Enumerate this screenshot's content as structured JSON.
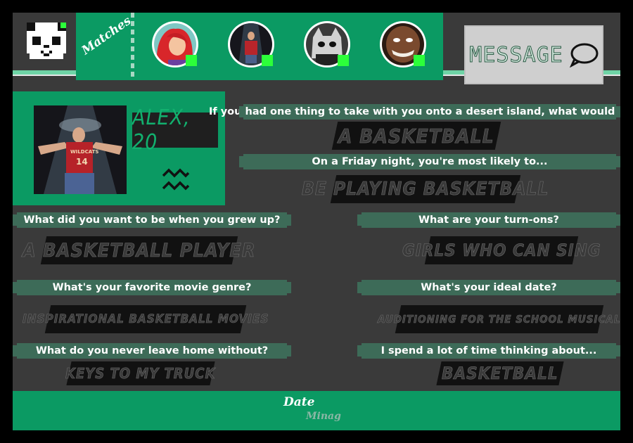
{
  "nav": {
    "matches_label": "Matches",
    "message_label": "MESSAGE"
  },
  "matches": [
    {
      "name": "match-ariel",
      "status_color": "#2cff3a"
    },
    {
      "name": "match-alex",
      "status_color": "#2cff3a"
    },
    {
      "name": "match-cat",
      "status_color": "#2cff3a"
    },
    {
      "name": "match-grin",
      "status_color": "#2cff3a"
    }
  ],
  "profile": {
    "name": "ALEX, 20",
    "zodiac_icon": "aquarius-icon"
  },
  "qa": [
    {
      "question": "If you had one thing to take with you onto a desert island, what would it be?",
      "answer": "A BASKETBALL"
    },
    {
      "question": "On a Friday night, you're most likely to...",
      "answer": "BE PLAYING BASKETBALL"
    },
    {
      "question": "What did you want to be when you grew up?",
      "answer": "A BASKETBALL PLAYER"
    },
    {
      "question": "What are your turn-ons?",
      "answer": "GIRLS WHO CAN SING"
    },
    {
      "question": "What's your favorite movie genre?",
      "answer": "INSPIRATIONAL BASKETBALL MOVIES"
    },
    {
      "question": "What's your ideal date?",
      "answer": "AUDITIONING FOR THE SCHOOL MUSICAL"
    },
    {
      "question": "What do you never leave home without?",
      "answer": "KEYS TO MY TRUCK"
    },
    {
      "question": "I spend a lot of time thinking about...",
      "answer": "BASKETBALL"
    }
  ],
  "footer": {
    "logo_line1": "Date",
    "logo_line2": "Minag"
  },
  "colors": {
    "accent_green": "#0b9a63",
    "question_bar": "#3d6b58",
    "online_dot": "#2cff3a"
  }
}
